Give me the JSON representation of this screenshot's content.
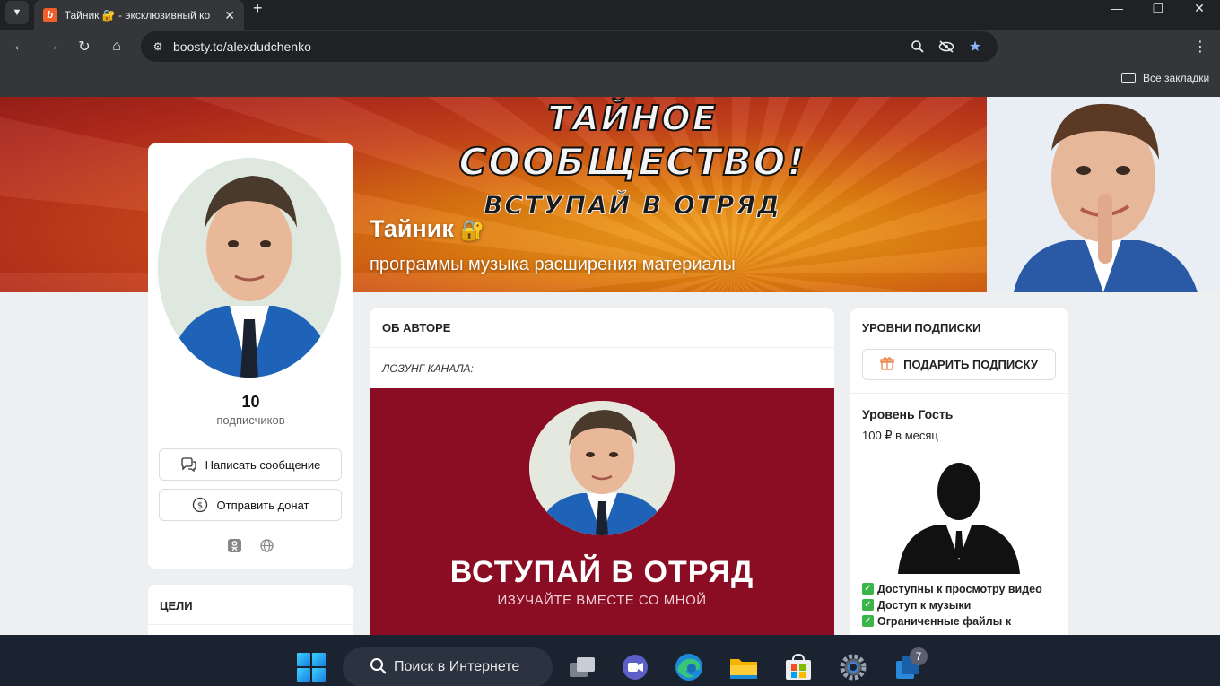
{
  "browser": {
    "tab": {
      "title": "Тайник 🔐 - эксклюзивный ко",
      "favicon": "boosty-icon"
    },
    "url": "boosty.to/alexdudchenko",
    "bookmarks_label": "Все закладки"
  },
  "cover": {
    "headline_line1": "ТАЙНОЕ",
    "headline_line2": "СООБЩЕСТВО!",
    "headline_line3": "ВСТУПАЙ В ОТРЯД",
    "title": "Тайник",
    "subtitle": "программы музыка расширения материалы"
  },
  "profile": {
    "subscribers_count": "10",
    "subscribers_label": "подписчиков",
    "message_button": "Написать сообщение",
    "donate_button": "Отправить донат",
    "socials": [
      "odnoklassniki-icon",
      "globe-icon"
    ]
  },
  "goals": {
    "title": "ЦЕЛИ"
  },
  "about": {
    "header": "ОБ АВТОРЕ",
    "slogan": "ЛОЗУНГ КАНАЛА:",
    "promo_title": "ВСТУПАЙ В ОТРЯД",
    "promo_subtitle": "ИЗУЧАЙТЕ ВМЕСТЕ СО МНОЙ"
  },
  "tiers": {
    "header": "УРОВНИ ПОДПИСКИ",
    "gift_button": "ПОДАРИТЬ ПОДПИСКУ",
    "tier_name": "Уровень Гость",
    "tier_price": "100 ₽ в месяц",
    "perks": [
      "Доступны к просмотру видео",
      "Доступ к музыки",
      "Ограниченные файлы к скачиванию"
    ]
  },
  "taskbar": {
    "search_label": "Поиск в Интернете",
    "badge_count": "7"
  },
  "colors": {
    "brand_orange": "#f15f2c",
    "promo_bg": "#8a0d24",
    "check_green": "#3bb54a",
    "star_blue": "#8ab4f8"
  }
}
